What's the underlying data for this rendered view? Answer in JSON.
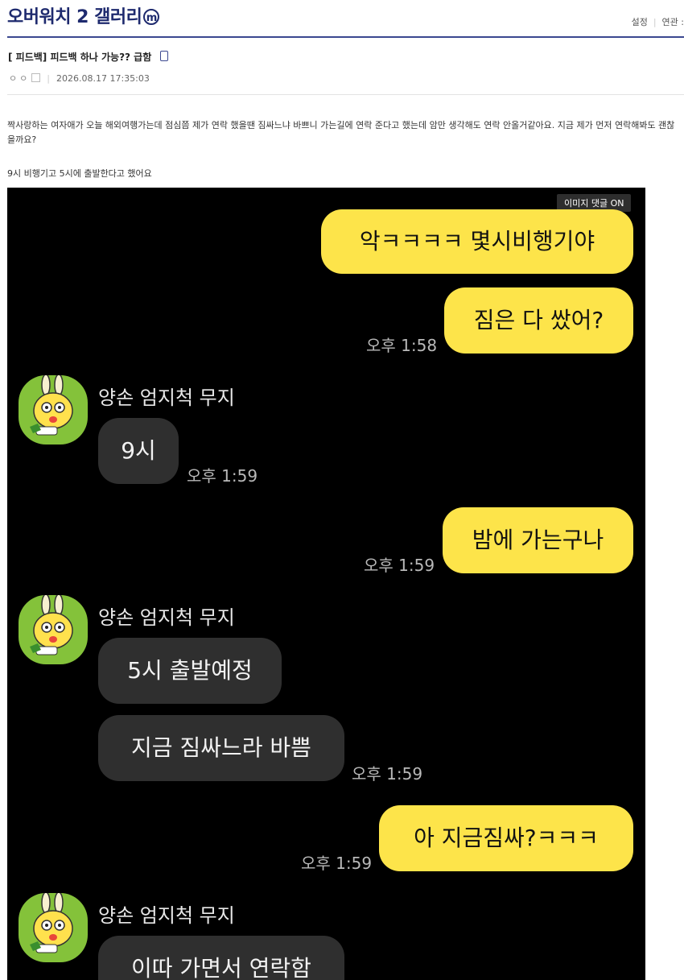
{
  "header": {
    "gallery_name": "오버워치 2 갤러리",
    "gallery_badge": "m",
    "links": [
      "설정",
      "연관 :"
    ]
  },
  "post": {
    "title": "[  피드백] 피드백 하나 가능?? 급함",
    "author_dots": "ㅇㅇ",
    "date": "2026.08.17 17:35:03",
    "body_line1": "짝사랑하는 여자애가 오늘 해외여행가는데 점심쯤 제가 연락 했을땐 짐싸느냐 바쁘니 가는길에 연락 준다고 했는데 암만 생각해도 연락 안올거같아요. 지금 제가 먼저 연락해봐도 괜찮을까요?",
    "body_line2": "9시 비행기고 5시에 출발한다고 했어요"
  },
  "image": {
    "comment_button": "이미지 댓글 ON",
    "messages": [
      {
        "from": "me",
        "text": "악ㅋㅋㅋㅋ 몇시비행기야"
      },
      {
        "from": "me",
        "text": "짐은 다 쌌어?",
        "time": "오후 1:58"
      },
      {
        "from": "them",
        "name": "양손 엄지척 무지",
        "text": "9시",
        "time": "오후 1:59"
      },
      {
        "from": "me",
        "text": "밤에 가는구나",
        "time": "오후 1:59"
      },
      {
        "from": "them",
        "name": "양손 엄지척 무지",
        "text": "5시 출발예정"
      },
      {
        "from": "them",
        "text": "지금 짐싸느라 바쁨",
        "time": "오후 1:59"
      },
      {
        "from": "me",
        "text": "아 지금짐싸?ㅋㅋㅋ",
        "time": "오후 1:59"
      },
      {
        "from": "them",
        "name": "양손 엄지척 무지",
        "text": "이따 가면서 연락함"
      }
    ]
  }
}
